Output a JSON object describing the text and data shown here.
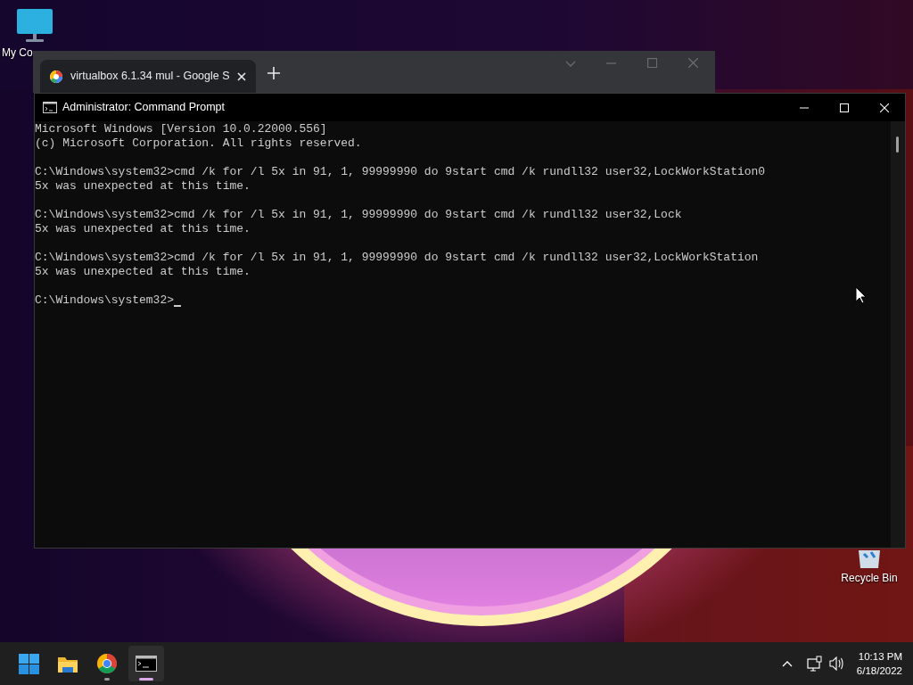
{
  "desktop": {
    "icons": [
      {
        "kind": "computer",
        "label": "My Co"
      },
      {
        "kind": "recycle",
        "label": "Recycle Bin"
      }
    ]
  },
  "browser_window": {
    "tab": {
      "title": "virtualbox 6.1.34 mul - Google S"
    }
  },
  "console_window": {
    "title": "Administrator: Command Prompt",
    "blocks": [
      [
        "Microsoft Windows [Version 10.0.22000.556]",
        "(c) Microsoft Corporation. All rights reserved."
      ],
      [
        "C:\\Windows\\system32>cmd /k for /l 5x in 91, 1, 99999990 do 9start cmd /k rundll32 user32,LockWorkStation0",
        "5x was unexpected at this time."
      ],
      [
        "C:\\Windows\\system32>cmd /k for /l 5x in 91, 1, 99999990 do 9start cmd /k rundll32 user32,Lock",
        "5x was unexpected at this time."
      ],
      [
        "C:\\Windows\\system32>cmd /k for /l 5x in 91, 1, 99999990 do 9start cmd /k rundll32 user32,LockWorkStation",
        "5x was unexpected at this time."
      ]
    ],
    "prompt": "C:\\Windows\\system32>"
  },
  "taskbar": {
    "apps": [
      {
        "kind": "start",
        "running": false,
        "selected": false
      },
      {
        "kind": "explorer",
        "running": false,
        "selected": false
      },
      {
        "kind": "chrome",
        "running": true,
        "selected": false
      },
      {
        "kind": "terminal",
        "running": true,
        "selected": true
      }
    ],
    "clock": {
      "time": "10:13 PM",
      "date": "6/18/2022"
    }
  }
}
